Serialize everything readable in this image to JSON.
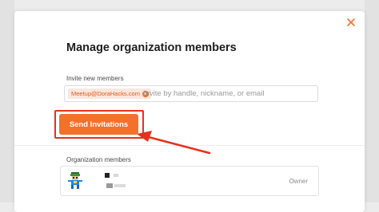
{
  "modal": {
    "title": "Manage organization members",
    "close_icon": "close-icon"
  },
  "invite": {
    "label": "Invite new members",
    "chip": "Meetup@DoraHacks.com",
    "placeholder": "Invite by handle, nickname, or email",
    "send_label": "Send Invitations"
  },
  "members": {
    "label": "Organization members",
    "items": [
      {
        "role": "Owner"
      }
    ]
  },
  "colors": {
    "accent": "#f4712b",
    "highlight": "#e5321e"
  }
}
